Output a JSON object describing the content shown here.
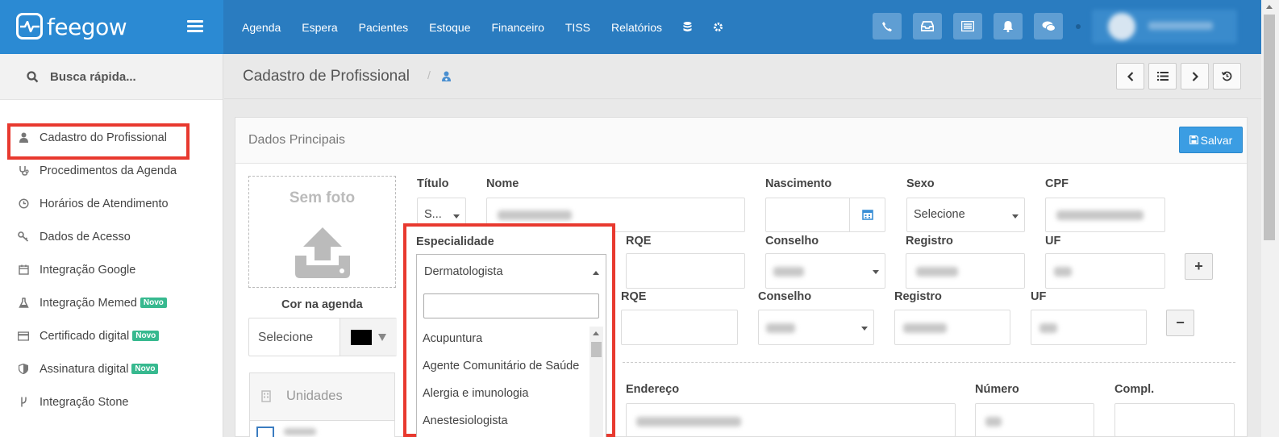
{
  "brand": {
    "name": "feegow"
  },
  "nav": {
    "items": [
      "Agenda",
      "Espera",
      "Pacientes",
      "Estoque",
      "Financeiro",
      "TISS",
      "Relatórios"
    ]
  },
  "sidebar": {
    "search_label": "Busca rápida...",
    "items": [
      {
        "label": "Cadastro do Profissional",
        "icon": "user-doctor-icon"
      },
      {
        "label": "Procedimentos da Agenda",
        "icon": "stethoscope-icon"
      },
      {
        "label": "Horários de Atendimento",
        "icon": "clock-icon"
      },
      {
        "label": "Dados de Acesso",
        "icon": "key-icon"
      },
      {
        "label": "Integração Google",
        "icon": "calendar-icon"
      },
      {
        "label": "Integração Memed",
        "icon": "flask-icon",
        "badge": "Novo"
      },
      {
        "label": "Certificado digital",
        "icon": "credit-card-icon",
        "badge": "Novo"
      },
      {
        "label": "Assinatura digital",
        "icon": "shield-icon",
        "badge": "Novo"
      },
      {
        "label": "Integração Stone",
        "icon": "fork-icon"
      }
    ]
  },
  "header": {
    "title": "Cadastro de Profissional",
    "separator": "/"
  },
  "panel": {
    "title": "Dados Principais",
    "save_label": "Salvar",
    "photo_label": "Sem foto",
    "cor_label": "Cor na agenda",
    "cor_select": "Selecione",
    "unidades_label": "Unidades"
  },
  "form": {
    "titulo_label": "Título",
    "titulo_value": "S...",
    "nome_label": "Nome",
    "nascimento_label": "Nascimento",
    "sexo_label": "Sexo",
    "sexo_value": "Selecione",
    "cpf_label": "CPF",
    "especialidade_label": "Especialidade",
    "especialidade_value": "Dermatologista",
    "rqe_label": "RQE",
    "conselho_label": "Conselho",
    "registro_label": "Registro",
    "uf_label": "UF",
    "endereco_label": "Endereço",
    "numero_label": "Número",
    "compl_label": "Compl."
  },
  "dropdown": {
    "options": [
      "Acupuntura",
      "Agente Comunitário de Saúde",
      "Alergia e imunologia",
      "Anestesiologista"
    ]
  },
  "colors": {
    "topbar": "#2a7cc0",
    "brand": "#2b8ad3",
    "highlight": "#e8392f",
    "save": "#3b9de3",
    "badge": "#37b98f"
  }
}
